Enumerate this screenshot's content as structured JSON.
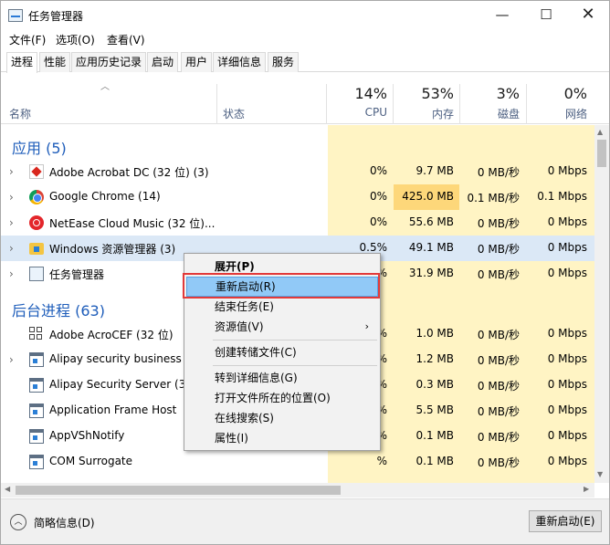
{
  "window": {
    "title": "任务管理器",
    "minimize": "—",
    "maximize": "☐",
    "close": "✕"
  },
  "menu": [
    "文件(F)",
    "选项(O)",
    "查看(V)"
  ],
  "tabs": [
    "进程",
    "性能",
    "应用历史记录",
    "启动",
    "用户",
    "详细信息",
    "服务"
  ],
  "columns": {
    "name": "名称",
    "status": "状态",
    "cpu": {
      "percent": "14%",
      "label": "CPU"
    },
    "memory": {
      "percent": "53%",
      "label": "内存"
    },
    "disk": {
      "percent": "3%",
      "label": "磁盘"
    },
    "network": {
      "percent": "0%",
      "label": "网络"
    }
  },
  "groups": {
    "apps": "应用 (5)",
    "background": "后台进程 (63)"
  },
  "apps": [
    {
      "name": "Adobe Acrobat DC (32 位) (3)",
      "cpu": "0%",
      "mem": "9.7 MB",
      "disk": "0 MB/秒",
      "net": "0 Mbps",
      "icon": "acrobat-icon"
    },
    {
      "name": "Google Chrome (14)",
      "cpu": "0%",
      "mem": "425.0 MB",
      "disk": "0.1 MB/秒",
      "net": "0.1 Mbps",
      "icon": "chrome-icon"
    },
    {
      "name": "NetEase Cloud Music (32 位)...",
      "cpu": "0%",
      "mem": "55.6 MB",
      "disk": "0 MB/秒",
      "net": "0 Mbps",
      "icon": "netease-icon"
    },
    {
      "name": "Windows 资源管理器 (3)",
      "cpu": "0.5%",
      "mem": "49.1 MB",
      "disk": "0 MB/秒",
      "net": "0 Mbps",
      "icon": "folder-icon"
    },
    {
      "name": "任务管理器",
      "cpu": "%",
      "mem": "31.9 MB",
      "disk": "0 MB/秒",
      "net": "0 Mbps",
      "icon": "taskmgr-icon"
    }
  ],
  "background": [
    {
      "name": "Adobe AcroCEF (32 位)",
      "cpu": "%",
      "mem": "1.0 MB",
      "disk": "0 MB/秒",
      "net": "0 Mbps",
      "icon": "acrocef-icon"
    },
    {
      "name": "Alipay security business s",
      "cpu": "%",
      "mem": "1.2 MB",
      "disk": "0 MB/秒",
      "net": "0 Mbps",
      "icon": "app-icon"
    },
    {
      "name": "Alipay Security Server (32",
      "cpu": "%",
      "mem": "0.3 MB",
      "disk": "0 MB/秒",
      "net": "0 Mbps",
      "icon": "app-icon"
    },
    {
      "name": "Application Frame Host",
      "cpu": "%",
      "mem": "5.5 MB",
      "disk": "0 MB/秒",
      "net": "0 Mbps",
      "icon": "app-icon"
    },
    {
      "name": "AppVShNotify",
      "cpu": "%",
      "mem": "0.1 MB",
      "disk": "0 MB/秒",
      "net": "0 Mbps",
      "icon": "app-icon"
    },
    {
      "name": "COM Surrogate",
      "cpu": "%",
      "mem": "0.1 MB",
      "disk": "0 MB/秒",
      "net": "0 Mbps",
      "icon": "app-icon"
    }
  ],
  "context_menu": {
    "expand": "展开(P)",
    "restart": "重新启动(R)",
    "end_task": "结束任务(E)",
    "resource_values": "资源值(V)",
    "create_dump": "创建转储文件(C)",
    "go_details": "转到详细信息(G)",
    "open_location": "打开文件所在的位置(O)",
    "search_online": "在线搜索(S)",
    "properties": "属性(I)"
  },
  "footer": {
    "fewer_details": "简略信息(D)",
    "restart_button": "重新启动(E)"
  },
  "colors": {
    "accent": "#1e5dba",
    "resource_bg": "#fff4c4",
    "mem_hot": "#fdd77a",
    "highlight_row": "#dbe8f6",
    "menu_hover": "#91c9f7",
    "focus_ring": "#e23a3a"
  }
}
